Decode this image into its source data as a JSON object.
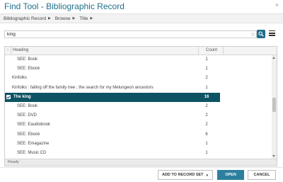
{
  "window": {
    "title": "Find Tool - Bibliographic Record",
    "close_glyph": "×"
  },
  "breadcrumb": [
    {
      "label": "Bibliographic Record"
    },
    {
      "label": "Browse"
    },
    {
      "label": "Title"
    }
  ],
  "search": {
    "value": "king",
    "placeholder": ""
  },
  "grid": {
    "sort_glyph": "↑",
    "columns": {
      "heading": "Heading",
      "count": "Count"
    },
    "rows": [
      {
        "heading": "SEE: Book",
        "count": "1",
        "indent": true,
        "selected": false
      },
      {
        "heading": "SEE: Ebook",
        "count": "1",
        "indent": true,
        "selected": false
      },
      {
        "heading": "Kinfolks",
        "count": "2",
        "indent": false,
        "selected": false
      },
      {
        "heading": "Kinfolks : falling off the family tree ; the search for my Melungeon ancestors",
        "count": "1",
        "indent": false,
        "selected": false
      },
      {
        "heading": "The king",
        "count": "16",
        "indent": false,
        "selected": true
      },
      {
        "heading": "SEE: Book",
        "count": "2",
        "indent": true,
        "selected": false
      },
      {
        "heading": "SEE: DVD",
        "count": "2",
        "indent": true,
        "selected": false
      },
      {
        "heading": "SEE: Eaudiobook",
        "count": "2",
        "indent": true,
        "selected": false
      },
      {
        "heading": "SEE: Ebook",
        "count": "6",
        "indent": true,
        "selected": false
      },
      {
        "heading": "SEE: Emagazine",
        "count": "1",
        "indent": true,
        "selected": false
      },
      {
        "heading": "SEE: Music CD",
        "count": "1",
        "indent": true,
        "selected": false
      }
    ],
    "status": "Ready"
  },
  "buttons": {
    "add_to_record_set": "ADD TO RECORD SET",
    "open": "OPEN",
    "cancel": "CANCEL"
  },
  "colors": {
    "accent": "#1f6f8b",
    "selected_row": "#0d5363",
    "open_button": "#2c7f9f"
  },
  "icons": {
    "close": "close-icon",
    "star": "star-icon",
    "search": "search-icon",
    "menu": "hamburger-menu-icon",
    "caret": "caret-right-icon"
  }
}
